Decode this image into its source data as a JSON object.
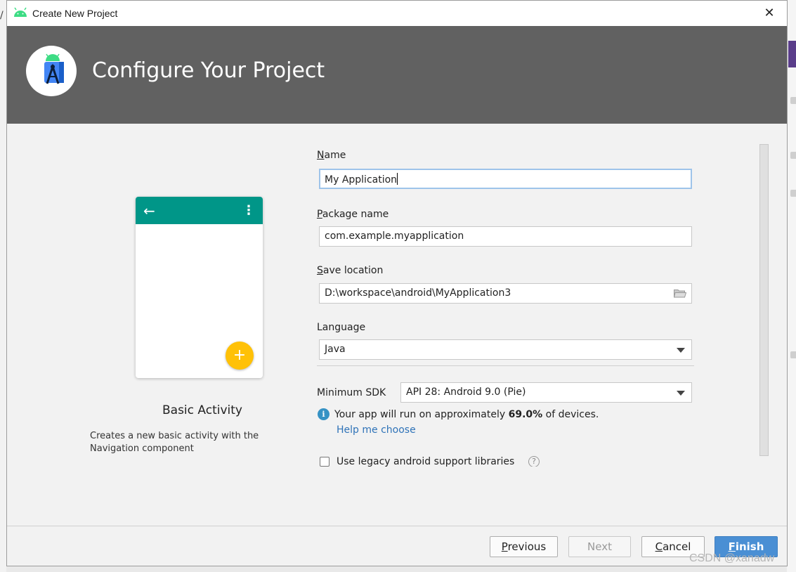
{
  "window": {
    "title": "Create New Project",
    "close_glyph": "✕",
    "header_title": "Configure Your Project"
  },
  "template": {
    "activity_name": "Basic Activity",
    "description": "Creates a new basic activity with the Navigation component",
    "appbar_color": "#009688",
    "fab_color": "#ffc107",
    "back_glyph": "←",
    "menu_glyph": "⋮",
    "fab_glyph": "+"
  },
  "form": {
    "name_label_access": "N",
    "name_label_rest": "ame",
    "name_value": "My Application",
    "package_label_access": "P",
    "package_label_rest": "ackage name",
    "package_value": "com.example.myapplication",
    "save_label_access": "S",
    "save_label_rest": "ave location",
    "save_value": "D:\\workspace\\android\\MyApplication3",
    "language_label": "Language",
    "language_value": "Java",
    "min_sdk_label": "Minimum SDK",
    "min_sdk_value": "API 28: Android 9.0 (Pie)",
    "info_prefix": "Your app will run on approximately ",
    "info_percent": "69.0%",
    "info_suffix": " of devices.",
    "help_link": "Help me choose",
    "legacy_checkbox_label": "Use legacy android support libraries",
    "legacy_checked": false,
    "help_q": "?"
  },
  "buttons": {
    "previous_access": "P",
    "previous_rest": "revious",
    "next": "Next",
    "cancel_access": "C",
    "cancel_rest": "ancel",
    "finish_access": "F",
    "finish_rest": "inish"
  },
  "watermark": "CSDN @xanadw",
  "colors": {
    "header_bg": "#616161",
    "primary_button": "#4a8fd4",
    "link": "#2f73b8",
    "info_icon": "#3592c4"
  }
}
